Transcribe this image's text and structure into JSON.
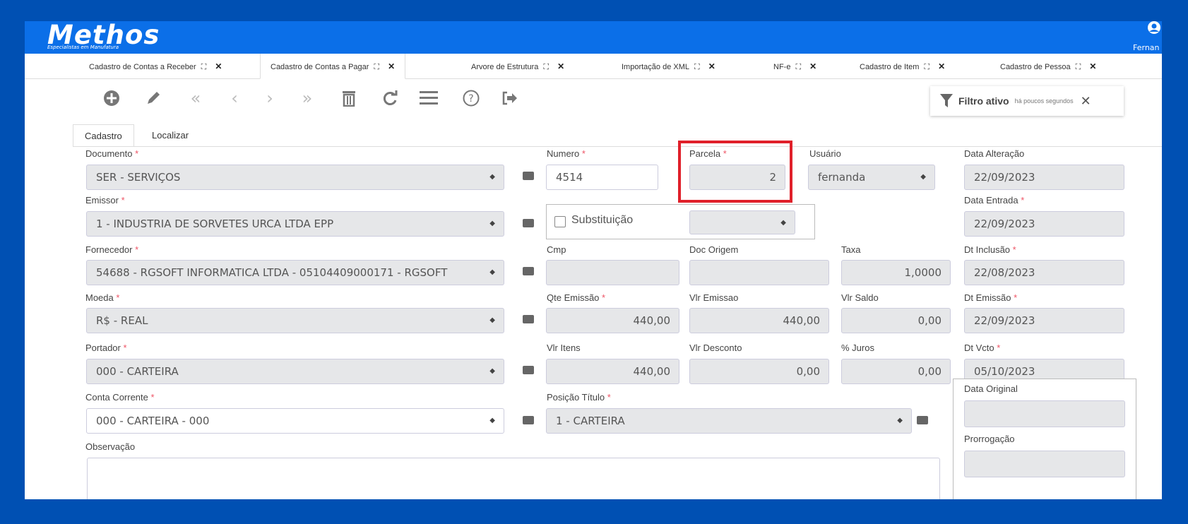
{
  "app": {
    "logo": "Methos",
    "tagline": "Especialistas em Manufatura",
    "user_name": "Fernan",
    "brand_color": "#0b6fe8",
    "background_color": "#0050b3"
  },
  "tabs": [
    {
      "label": "Cadastro de Contas a Receber",
      "active": false
    },
    {
      "label": "Cadastro de Contas a Pagar",
      "active": true
    },
    {
      "label": "Arvore de Estrutura",
      "active": false
    },
    {
      "label": "Importação de XML",
      "active": false
    },
    {
      "label": "NF-e",
      "active": false
    },
    {
      "label": "Cadastro de Item",
      "active": false
    },
    {
      "label": "Cadastro de Pessoa",
      "active": false
    }
  ],
  "toolbar": {
    "icons": [
      "plus-circle",
      "pencil",
      "first",
      "previous",
      "next",
      "last",
      "trash",
      "refresh",
      "list",
      "help",
      "exit"
    ]
  },
  "filter": {
    "title": "Filtro ativo",
    "subtitle": "há poucos segundos",
    "close": "✕"
  },
  "subtabs": [
    {
      "label": "Cadastro",
      "active": true
    },
    {
      "label": "Localizar",
      "active": false
    }
  ],
  "form": {
    "documento": {
      "label": "Documento",
      "value": "SER - SERVIÇOS"
    },
    "numero": {
      "label": "Numero",
      "value": "4514"
    },
    "parcela": {
      "label": "Parcela",
      "value": "2"
    },
    "usuario": {
      "label": "Usuário",
      "value": "fernanda"
    },
    "data_alteracao": {
      "label": "Data Alteração",
      "value": "22/09/2023"
    },
    "emissor": {
      "label": "Emissor",
      "value": "1 - INDUSTRIA DE SORVETES URCA LTDA EPP"
    },
    "substituicao": {
      "label": "Substituição",
      "value": ""
    },
    "data_entrada": {
      "label": "Data Entrada",
      "value": "22/09/2023"
    },
    "fornecedor": {
      "label": "Fornecedor",
      "value": "54688 - RGSOFT INFORMATICA LTDA - 05104409000171 - RGSOFT"
    },
    "cmp": {
      "label": "Cmp",
      "value": ""
    },
    "doc_origem": {
      "label": "Doc Origem",
      "value": ""
    },
    "taxa": {
      "label": "Taxa",
      "value": "1,0000"
    },
    "dt_inclusao": {
      "label": "Dt Inclusão",
      "value": "22/08/2023"
    },
    "moeda": {
      "label": "Moeda",
      "value": "R$   - REAL"
    },
    "qte_emissao": {
      "label": "Qte Emissão",
      "value": "440,00"
    },
    "vlr_emissao": {
      "label": "Vlr Emissao",
      "value": "440,00"
    },
    "vlr_saldo": {
      "label": "Vlr Saldo",
      "value": "0,00"
    },
    "dt_emissao": {
      "label": "Dt Emissão",
      "value": "22/09/2023"
    },
    "portador": {
      "label": "Portador",
      "value": "000 - CARTEIRA"
    },
    "vlr_itens": {
      "label": "Vlr Itens",
      "value": "440,00"
    },
    "vlr_desconto": {
      "label": "Vlr Desconto",
      "value": "0,00"
    },
    "juros": {
      "label": "% Juros",
      "value": "0,00"
    },
    "dt_vcto": {
      "label": "Dt Vcto",
      "value": "05/10/2023"
    },
    "conta_corrente": {
      "label": "Conta Corrente",
      "value": "000 - CARTEIRA - 000"
    },
    "posicao_titulo": {
      "label": "Posição Título",
      "value": "1 - CARTEIRA"
    },
    "data_original": {
      "label": "Data Original",
      "value": ""
    },
    "observacao": {
      "label": "Observação",
      "value": ""
    },
    "prorrogacao": {
      "label": "Prorrogação",
      "value": ""
    },
    "required_mark": "*"
  }
}
